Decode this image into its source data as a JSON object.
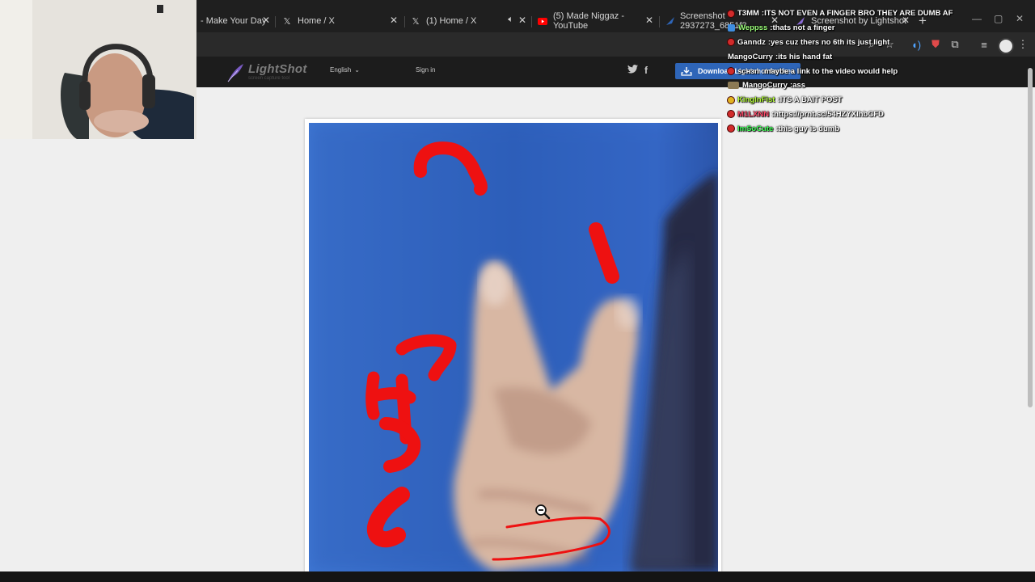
{
  "browser": {
    "tabs": [
      {
        "title": "- Make Your Day",
        "icon": "tab-favicon",
        "left": 0
      },
      {
        "title": "Home / X",
        "icon": "x-logo-icon"
      },
      {
        "title": "(1) Home / X",
        "icon": "x-logo-icon"
      },
      {
        "title": "(5) Made Niggaz - YouTube",
        "icon": "youtube-icon"
      },
      {
        "title": "Screenshot - 2937273_6851f3...",
        "icon": "lightshot-favicon"
      },
      {
        "title": "Screenshot by Lightshot",
        "icon": "lightshot-favicon"
      }
    ],
    "new_tab_label": "+"
  },
  "lightshot": {
    "logo_name": "LightShot",
    "logo_tagline": "screen capture tool",
    "language": "English",
    "language_arrow": "⌄",
    "sign_in": "Sign in",
    "download_label": "Download Lightshot for free",
    "social": {
      "twitter": "twitter-icon",
      "facebook": "f"
    }
  },
  "chat": {
    "messages": [
      {
        "user": "T3MM",
        "text": "ITS NOT EVEN A FINGER BRO THEY ARE DUMB AF",
        "color": "#ffffff",
        "badge": "red"
      },
      {
        "user": "Weppss",
        "text": "thats not a finger",
        "color": "#9cff7a",
        "badge": "blue"
      },
      {
        "user": "Ganndz",
        "text": "yes cuz thers no 6th its just light",
        "color": "#ffffff",
        "badge": "red"
      },
      {
        "user": "MangoCurry",
        "text": "its his hand fat",
        "color": "#ffffff",
        "badge": "none"
      },
      {
        "user": "sснзn",
        "text": "maybe a link to the video would help",
        "color": "#ffffff",
        "badge": "red"
      },
      {
        "user": "MangoCurry",
        "text": "ass",
        "color": "#ffffff",
        "badge": "emote"
      },
      {
        "user": "KingInFist",
        "text": "ITS A BAIT POST",
        "color": "#b8ff3c",
        "badge": "red-gold"
      },
      {
        "user": "M1LXNN",
        "text": "https://prnt.sc/54HZYXIhbCFD",
        "color": "#ff4a6a",
        "badge": "red"
      },
      {
        "user": "ImSoCute",
        "text": "this guy is dumb",
        "color": "#43ff5a",
        "badge": "red"
      }
    ]
  },
  "annotations": {
    "marks": [
      "7",
      "1",
      "3",
      "4",
      "5",
      "6"
    ]
  }
}
